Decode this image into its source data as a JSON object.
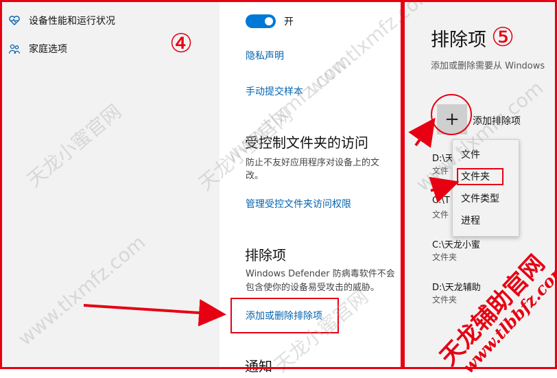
{
  "left_nav": {
    "items": [
      {
        "label": "设备性能和运行状况",
        "icon": "heart-icon"
      },
      {
        "label": "家庭选项",
        "icon": "family-icon"
      }
    ]
  },
  "step_markers": {
    "step4": "④",
    "step5": "⑤"
  },
  "middle": {
    "toggle_label": "开",
    "privacy_link": "隐私声明",
    "submit_sample_link": "手动提交样本",
    "cfa_title": "受控制文件夹的访问",
    "cfa_desc_line1": "防止不友好应用程序对设备上的文",
    "cfa_desc_line2": "改。",
    "cfa_link": "管理受控文件夹访问权限",
    "exclusions_title": "排除项",
    "exclusions_desc_line1": "Windows Defender 防病毒软件不会",
    "exclusions_desc_line2": "包含使你的设备易受攻击的威胁。",
    "exclusions_link": "添加或删除排除项",
    "notify_title": "通知"
  },
  "right": {
    "title": "排除项",
    "subtitle": "添加或删除需要从 Windows",
    "add_button_symbol": "+",
    "add_button_label": "添加排除项",
    "entries": [
      {
        "path": "D:\\天",
        "type": "文件"
      },
      {
        "path": "C:\\T",
        "type": "文件"
      },
      {
        "path": "C:\\天龙小蜜",
        "type": "文件夹"
      },
      {
        "path": "D:\\天龙辅助",
        "type": "文件夹"
      }
    ],
    "dropdown": [
      "文件",
      "文件夹",
      "文件类型",
      "进程"
    ]
  },
  "watermark": {
    "text1": "天龙小蜜官网",
    "text2": "www.tlxmfz.com"
  },
  "signature": {
    "chars": "天龙辅助官网",
    "url": "www.tlbbfz.com"
  },
  "colors": {
    "accent": "#0078d7",
    "link": "#0063b1",
    "annotation_red": "#e60012"
  }
}
